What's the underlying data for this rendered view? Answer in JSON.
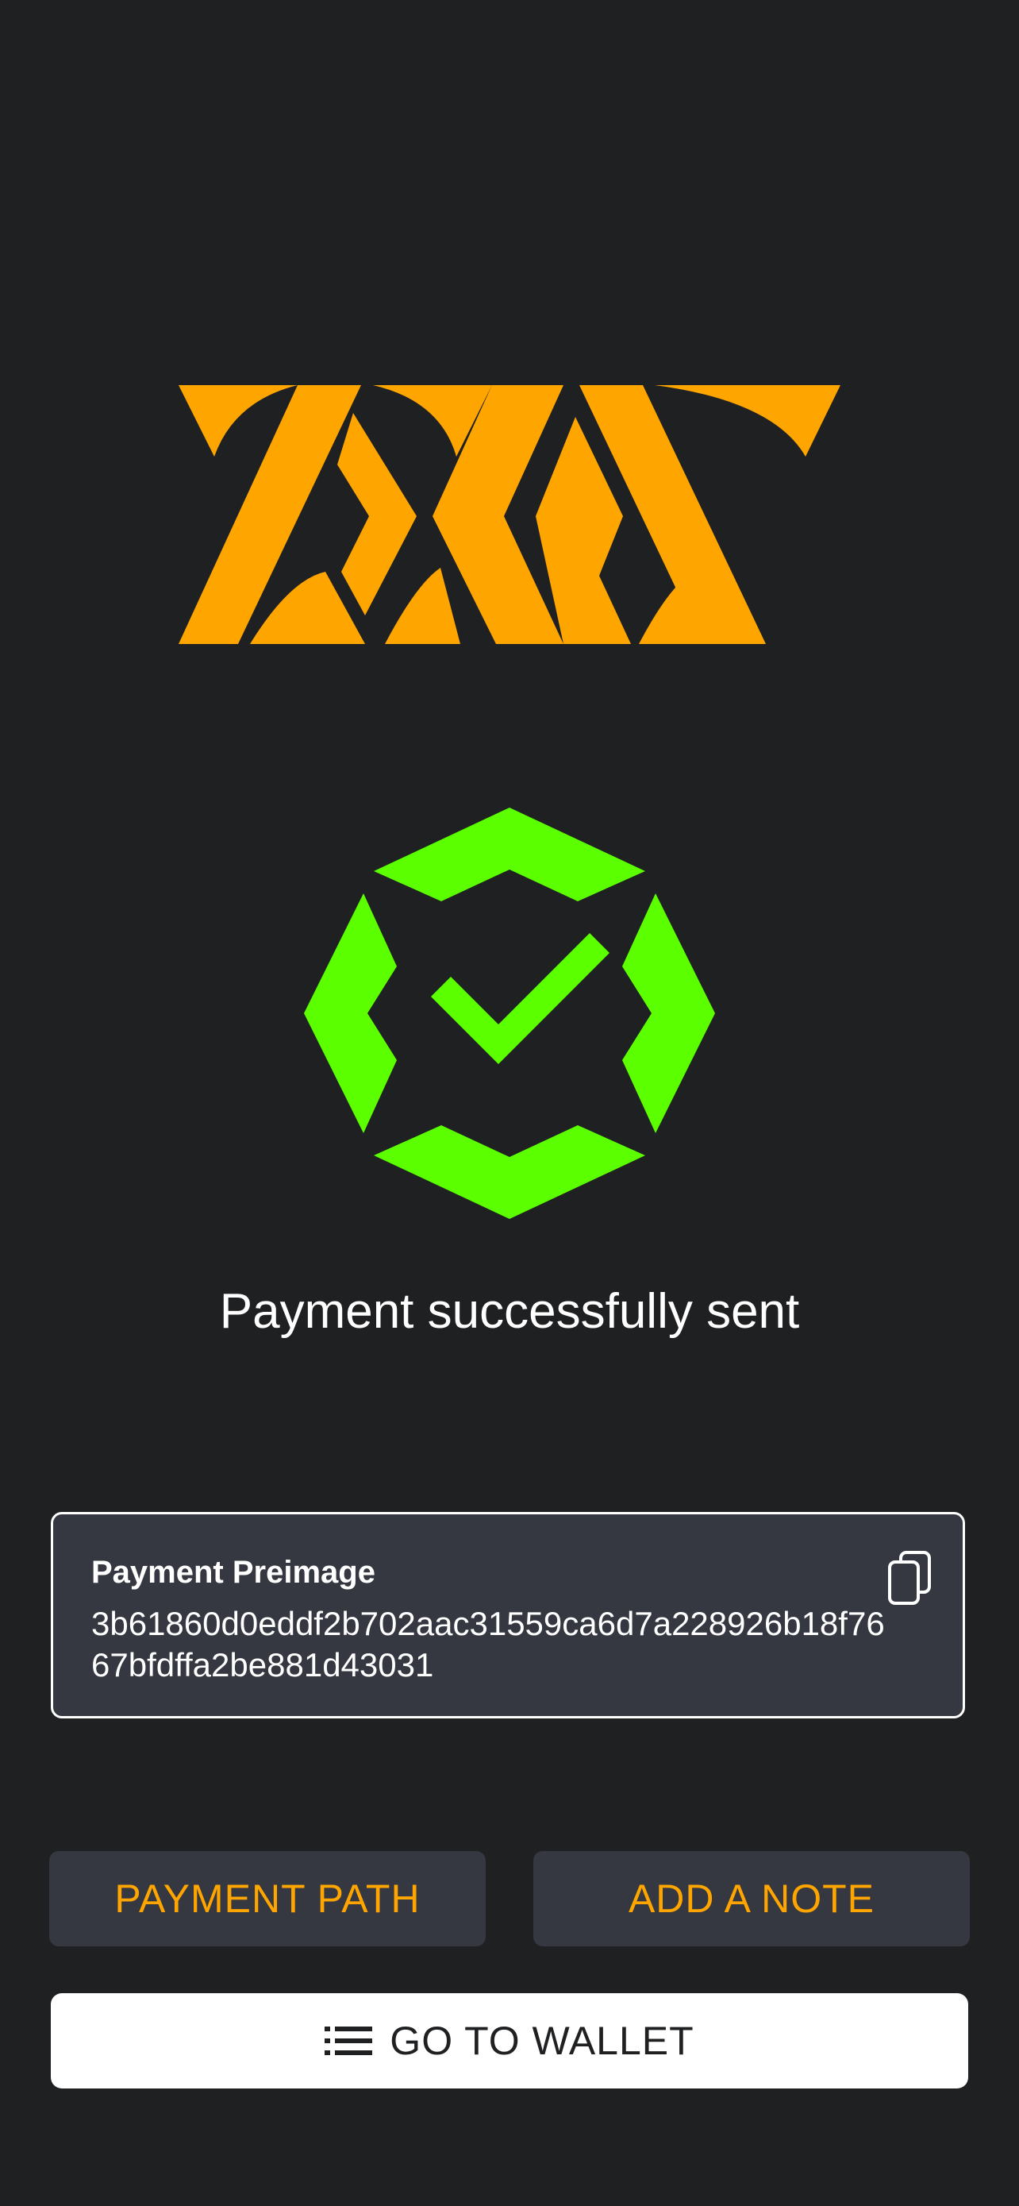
{
  "colors": {
    "background": "#1f2022",
    "brand_orange": "#ffa500",
    "success_green": "#5cff00",
    "card_background": "#353841",
    "text_primary": "#ffffff"
  },
  "logo": {
    "icon": "brand-logo"
  },
  "status": {
    "icon": "success-check-icon",
    "message": "Payment successfully sent"
  },
  "preimage": {
    "label": "Payment Preimage",
    "value": "3b61860d0eddf2b702aac31559ca6d7a228926b18f7667bfdffa2be881d43031",
    "copy_icon": "copy-icon"
  },
  "actions": {
    "payment_path": "PAYMENT PATH",
    "add_note": "ADD A NOTE",
    "go_to_wallet": "GO TO WALLET",
    "wallet_icon": "list-icon"
  }
}
